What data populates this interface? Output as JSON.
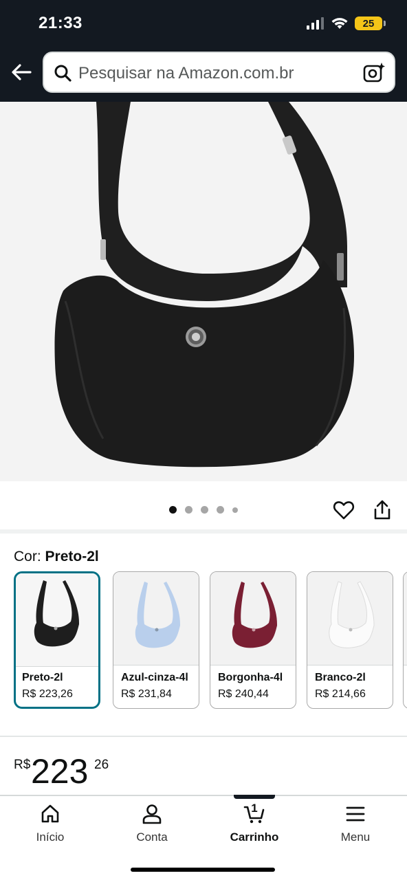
{
  "status_bar": {
    "time": "21:33",
    "battery": "25"
  },
  "header": {
    "search_placeholder": "Pesquisar na Amazon.com.br"
  },
  "product": {
    "color_prefix": "Cor:",
    "selected_color": "Preto-2l",
    "image_count": 5,
    "active_image_index": 0,
    "colors": [
      {
        "name": "Preto-2l",
        "price": "R$ 223,26",
        "bag_color": "#1e1e1e",
        "selected": true
      },
      {
        "name": "Azul-cinza-4l",
        "price": "R$ 231,84",
        "bag_color": "#b9cfec",
        "selected": false
      },
      {
        "name": "Borgonha-4l",
        "price": "R$ 240,44",
        "bag_color": "#7a1f33",
        "selected": false
      },
      {
        "name": "Branco-2l",
        "price": "R$ 214,66",
        "bag_color": "#f4f4f4",
        "selected": false
      }
    ],
    "price": {
      "currency": "R$",
      "whole": "223",
      "cents": "26"
    }
  },
  "bottom_nav": {
    "items": [
      {
        "label": "Início"
      },
      {
        "label": "Conta"
      },
      {
        "label": "Carrinho",
        "badge": "1"
      },
      {
        "label": "Menu"
      }
    ]
  },
  "colors": {
    "header_bg": "#131921",
    "selected_border": "#007185",
    "battery": "#f5c518"
  }
}
